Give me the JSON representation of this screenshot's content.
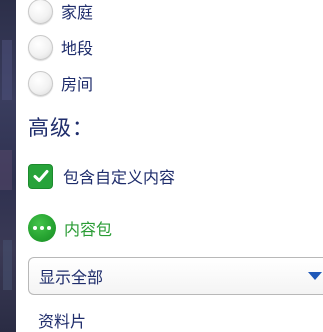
{
  "lot_type_options": [
    {
      "label": "家庭",
      "selected": false
    },
    {
      "label": "地段",
      "selected": false
    },
    {
      "label": "房间",
      "selected": false
    }
  ],
  "advanced": {
    "title": "高级：",
    "include_custom_content": {
      "label": "包含自定义内容",
      "checked": true
    }
  },
  "content_pack": {
    "label": "内容包",
    "icon": "more-dots-icon",
    "dropdown": {
      "selected": "显示全部"
    }
  },
  "list": {
    "first_item": "资料片"
  },
  "colors": {
    "text": "#1e2c6b",
    "green": "#27a33a",
    "pack_label": "#2a9c35",
    "arrow": "#1f58b8"
  }
}
